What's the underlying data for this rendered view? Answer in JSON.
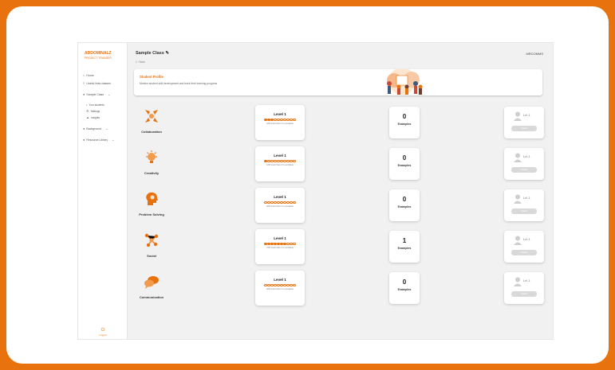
{
  "sidebar": {
    "brand_name": "ADDOMINALZ",
    "brand_sub": "PROJECT TRANSER",
    "items": [
      {
        "icon": "home-icon",
        "label": "Home"
      },
      {
        "icon": "list-icon",
        "label": "Useful links classes"
      },
      {
        "icon": "users-icon",
        "label": "Sample Class"
      },
      {
        "icon": "people-icon",
        "label": "Your students"
      },
      {
        "icon": "gear-icon",
        "label": "Settings"
      },
      {
        "icon": "chart-icon",
        "label": "Insights"
      },
      {
        "icon": "users-icon",
        "label": "Background"
      },
      {
        "icon": "users-icon",
        "label": "Resource Library"
      }
    ],
    "logout_label": "Logout"
  },
  "header": {
    "title": "Sample Class",
    "breadcrumb": "1 / Back",
    "user_name": "MRCOMMS"
  },
  "banner": {
    "title": "Student Profile",
    "subtitle": "Monitor student skill development and track their learning progress"
  },
  "skills": [
    {
      "name": "Collaboration",
      "icon": "collaboration-icon",
      "level_label": "Level 1",
      "filled": 3,
      "progress_text": "2/20 more than 1 to complete",
      "examples_count": "0",
      "examples_label": "Examples",
      "badge_level": "Lvl. 1",
      "badge_button": "Award"
    },
    {
      "name": "Creativity",
      "icon": "lightbulb-icon",
      "level_label": "Level 1",
      "filled": 1,
      "progress_text": "1/20 more than 1 to complete",
      "examples_count": "0",
      "examples_label": "Examples",
      "badge_level": "Lvl. 1",
      "badge_button": "Award"
    },
    {
      "name": "Problem Solving",
      "icon": "head-gears-icon",
      "level_label": "Level 1",
      "filled": 0,
      "progress_text": "0/20 more than 1 to complete",
      "examples_count": "0",
      "examples_label": "Examples",
      "badge_level": "Lvl. 1",
      "badge_button": "Award"
    },
    {
      "name": "Social",
      "icon": "network-icon",
      "level_label": "Level 1",
      "filled": 7,
      "progress_text": "7/20 more than 1 to complete",
      "examples_count": "1",
      "examples_label": "Examples",
      "badge_level": "Lvl. 1",
      "badge_button": "Award"
    },
    {
      "name": "Communication",
      "icon": "chat-icon",
      "level_label": "Level 1",
      "filled": 0,
      "progress_text": "0/20 more than 1 to complete",
      "examples_count": "0",
      "examples_label": "Examples",
      "badge_level": "Lvl. 1",
      "badge_button": "Award"
    }
  ],
  "colors": {
    "accent": "#e8730e",
    "frame": "#e8730e"
  }
}
